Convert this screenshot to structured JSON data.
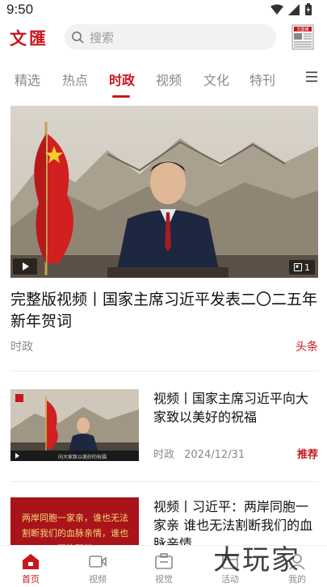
{
  "status": {
    "time": "9:50"
  },
  "header": {
    "logo": "文匯",
    "search_placeholder": "搜索",
    "paper_icon": "newspaper-icon",
    "paper_label": "文匯報"
  },
  "tabs": [
    {
      "label": "精选"
    },
    {
      "label": "热点"
    },
    {
      "label": "时政",
      "active": true
    },
    {
      "label": "视频"
    },
    {
      "label": "文化"
    },
    {
      "label": "特刊"
    }
  ],
  "hero": {
    "title": "完整版视频丨国家主席习近平发表二〇二五年新年贺词",
    "category": "时政",
    "tag": "头条",
    "count": "1"
  },
  "news": [
    {
      "title": "视频丨国家主席习近平向大家致以美好的祝福",
      "category": "时政",
      "date": "2024/12/31",
      "tag": "推荐",
      "thumb_caption": "向大家致以美好的祝福"
    },
    {
      "title": "视频丨习近平：两岸同胞一家亲 谁也无法割断我们的血脉亲情",
      "thumb_text": "两岸同胞一家亲，谁也无法割断我们的血脉亲情，谁也不能阻挡"
    }
  ],
  "bottom_nav": [
    {
      "label": "首页",
      "icon": "home-icon",
      "active": true
    },
    {
      "label": "视频",
      "icon": "video-icon"
    },
    {
      "label": "视觉",
      "icon": "camera-icon"
    },
    {
      "label": "活动",
      "icon": "activity-icon"
    },
    {
      "label": "我的",
      "icon": "profile-icon"
    }
  ],
  "watermark": "大玩家",
  "colors": {
    "accent": "#c8161d",
    "muted": "#8a8a8a"
  }
}
